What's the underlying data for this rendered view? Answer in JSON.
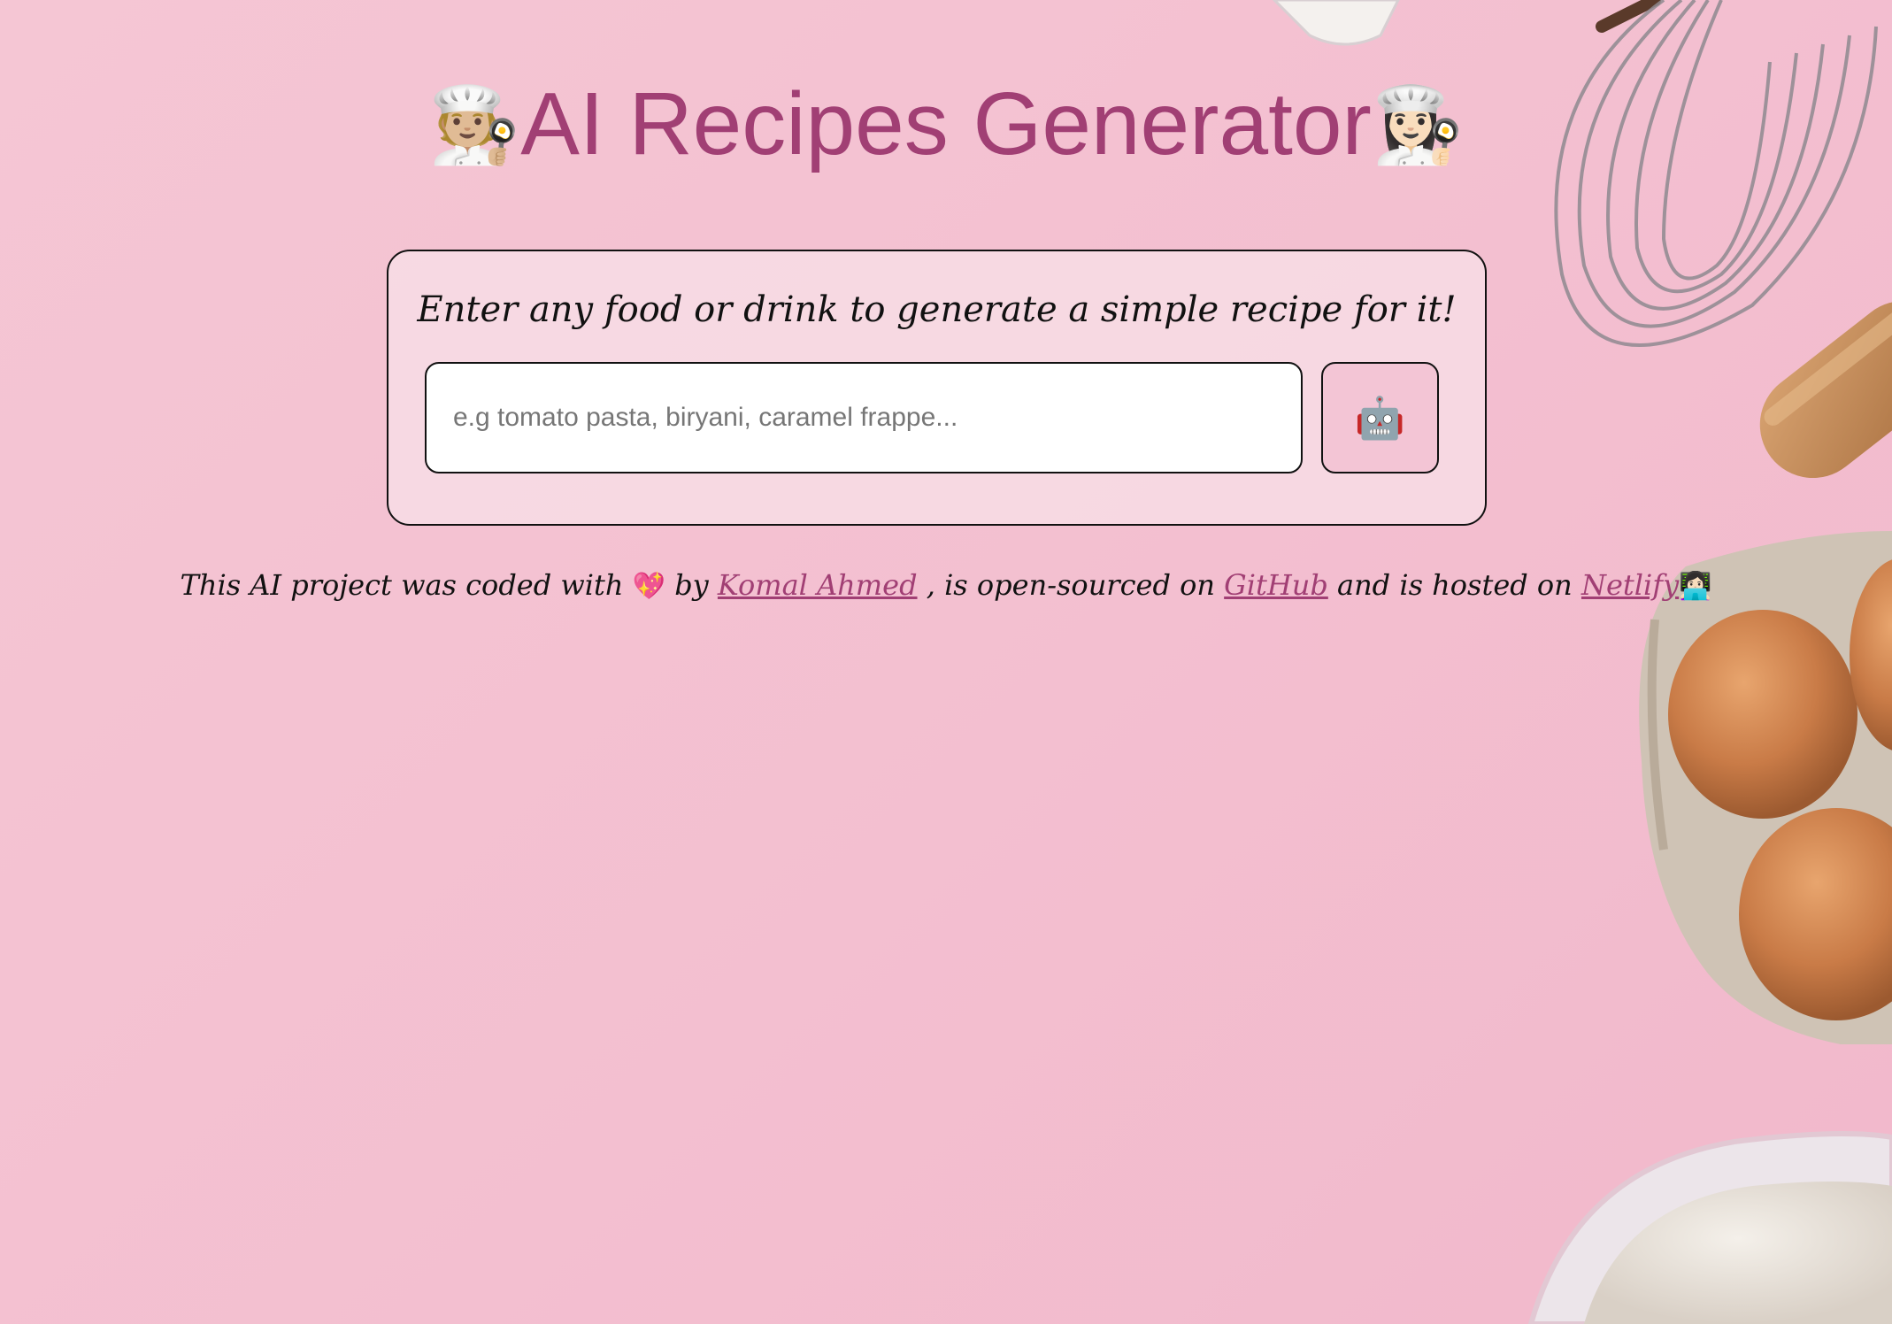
{
  "header": {
    "title": "AI Recipes Generator",
    "left_emoji": "🧑🏼‍🍳",
    "right_emoji": "👩🏻‍🍳"
  },
  "form": {
    "prompt": "Enter any food or drink to generate a simple recipe for it!",
    "input_placeholder": "e.g tomato pasta, biryani, caramel frappe...",
    "input_value": "",
    "submit_icon": "🤖"
  },
  "footer": {
    "part1": "This AI project was coded with",
    "heart_emoji": "💖",
    "part2": "by",
    "author_link": "Komal Ahmed",
    "part3": ", is open-sourced on",
    "github_link": "GitHub",
    "part4": "and is hosted on",
    "netlify_link": "Netlify",
    "coder_emoji": "👩🏻‍💻"
  },
  "colors": {
    "background": "#f4c2d2",
    "accent": "#a13f74",
    "card_border": "#111111",
    "button_bg": "#f3c5d5"
  },
  "icons": {
    "submit_button": "robot-icon",
    "title_left": "chef-icon",
    "title_right": "chef-icon",
    "footer_heart": "heart-icon",
    "footer_coder": "technologist-icon"
  }
}
